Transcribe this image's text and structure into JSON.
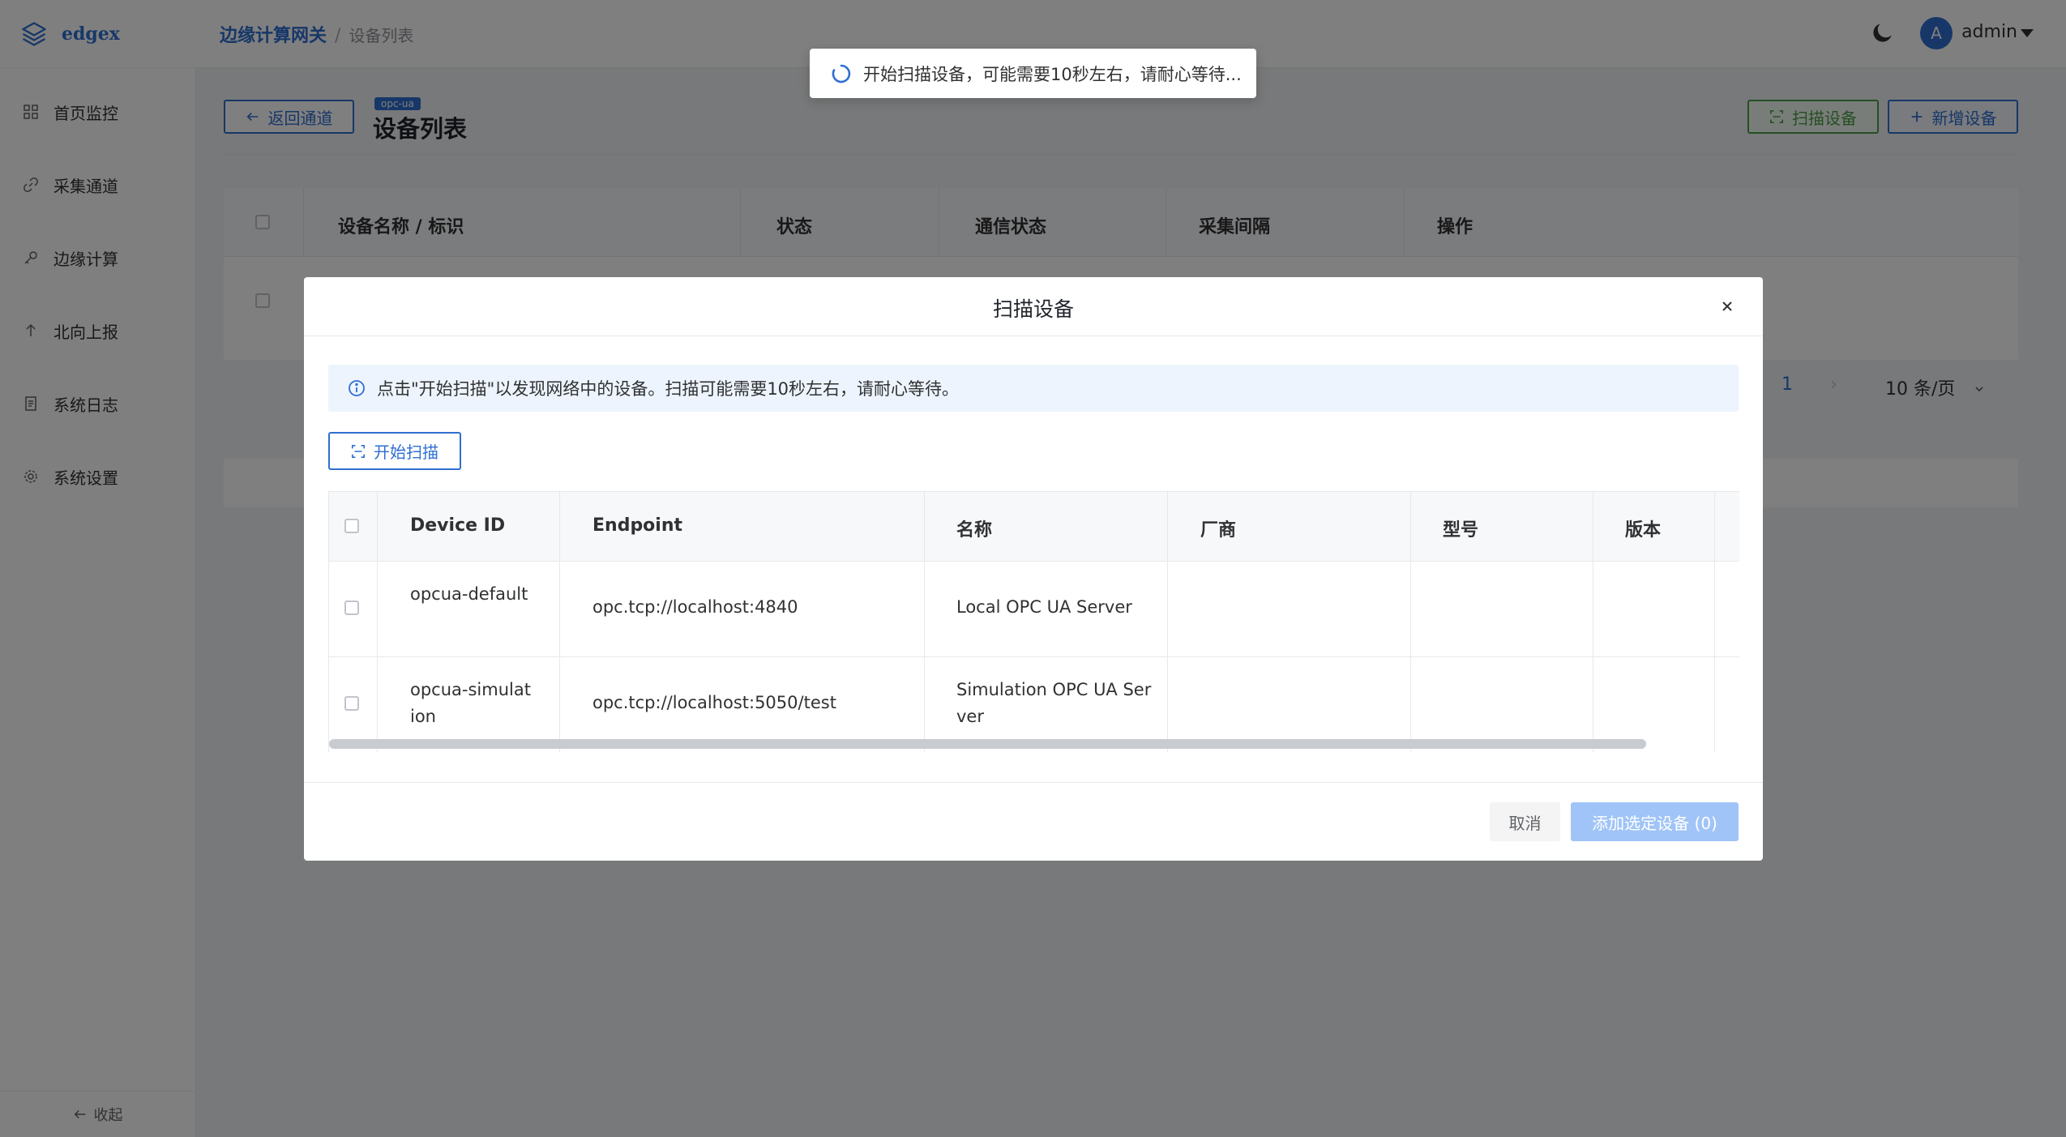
{
  "app": {
    "brand": "edgex"
  },
  "sidebar": {
    "items": [
      {
        "label": "首页监控",
        "icon": "grid-icon"
      },
      {
        "label": "采集通道",
        "icon": "link-icon"
      },
      {
        "label": "边缘计算",
        "icon": "key-icon"
      },
      {
        "label": "北向上报",
        "icon": "arrow-up-icon"
      },
      {
        "label": "系统日志",
        "icon": "document-icon"
      },
      {
        "label": "系统设置",
        "icon": "gear-icon"
      }
    ],
    "collapse_label": "收起"
  },
  "header": {
    "breadcrumb_root": "边缘计算网关",
    "breadcrumb_separator": "/",
    "breadcrumb_current": "设备列表",
    "avatar_letter": "A",
    "username": "admin"
  },
  "page": {
    "back_label": "返回通道",
    "protocol_tag": "opc-ua",
    "title": "设备列表",
    "scan_label": "扫描设备",
    "add_label": "新增设备",
    "table_columns": [
      "设备名称 / 标识",
      "状态",
      "通信状态",
      "采集间隔",
      "操作"
    ],
    "pager": {
      "current": "1",
      "next": "›",
      "page_size": "10 条/页"
    }
  },
  "toast": {
    "message": "开始扫描设备，可能需要10秒左右，请耐心等待..."
  },
  "dialog": {
    "title": "扫描设备",
    "close": "×",
    "info": "点击\"开始扫描\"以发现网络中的设备。扫描可能需要10秒左右，请耐心等待。",
    "start_label": "开始扫描",
    "columns": [
      "Device ID",
      "Endpoint",
      "名称",
      "厂商",
      "型号",
      "版本"
    ],
    "rows": [
      {
        "device_id": "opcua-default",
        "endpoint": "opc.tcp://localhost:4840",
        "name": "Local OPC UA Server",
        "vendor": "",
        "model": "",
        "version": ""
      },
      {
        "device_id": "opcua-simulation",
        "endpoint": "opc.tcp://localhost:5050/test",
        "name": "Simulation OPC UA Server",
        "vendor": "",
        "model": "",
        "version": ""
      }
    ],
    "cancel_label": "取消",
    "confirm_label": "添加选定设备 (0)"
  },
  "colors": {
    "primary": "#2f6fd1",
    "success": "#4a9e4a",
    "confirm_disabled": "#a0c4f7"
  }
}
